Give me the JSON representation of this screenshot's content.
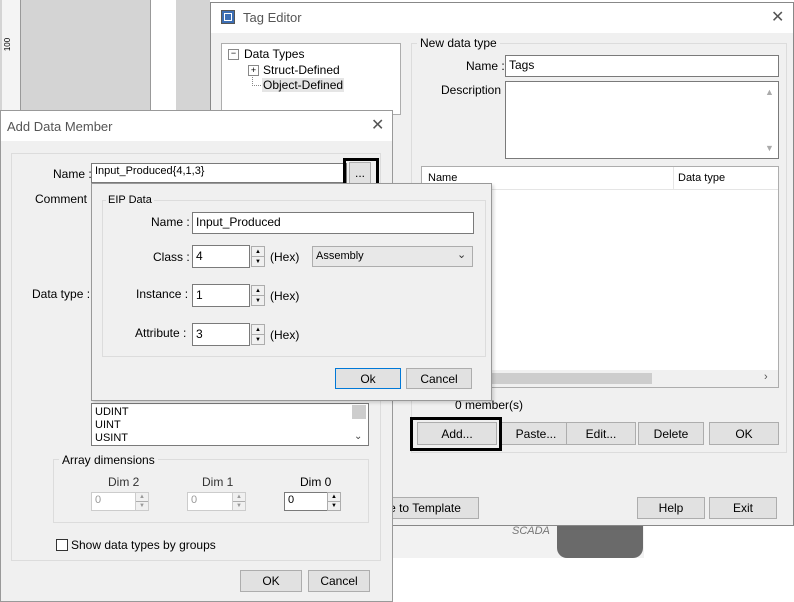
{
  "tag_editor": {
    "title": "Tag Editor",
    "tree": {
      "root": "Data Types",
      "items": [
        "Struct-Defined",
        "Object-Defined"
      ]
    },
    "group_label": "New data type",
    "name_label": "Name :",
    "name_value": "Tags",
    "description_label": "Description :",
    "columns": [
      "Name",
      "Data type"
    ],
    "member_count": "0 member(s)",
    "buttons": {
      "add": "Add...",
      "paste": "Paste...",
      "edit": "Edit...",
      "delete": "Delete",
      "ok": "OK",
      "help": "Help",
      "exit": "Exit",
      "save_template": "e to Template"
    }
  },
  "background": {
    "scada_text": "SCADA",
    "ruler_text": "100"
  },
  "add_data_member": {
    "title": "Add Data Member",
    "name_label": "Name :",
    "name_value": "Input_Produced{4,1,3}",
    "browse_label": "...",
    "comment_label": "Comment :",
    "datatype_label": "Data type :",
    "type_list": [
      "UDINT",
      "UINT",
      "USINT"
    ],
    "array_label": "Array dimensions",
    "dims": [
      {
        "label": "Dim 2",
        "value": "0"
      },
      {
        "label": "Dim 1",
        "value": "0"
      },
      {
        "label": "Dim 0",
        "value": "0"
      }
    ],
    "show_groups_label": "Show data types by groups",
    "ok": "OK",
    "cancel": "Cancel"
  },
  "eip_popup": {
    "group_label": "EIP Data",
    "name_label": "Name :",
    "name_value": "Input_Produced",
    "class_label": "Class :",
    "class_value": "4",
    "hex": "(Hex)",
    "class_type": "Assembly",
    "instance_label": "Instance :",
    "instance_value": "1",
    "attribute_label": "Attribute :",
    "attribute_value": "3",
    "ok": "Ok",
    "cancel": "Cancel"
  }
}
